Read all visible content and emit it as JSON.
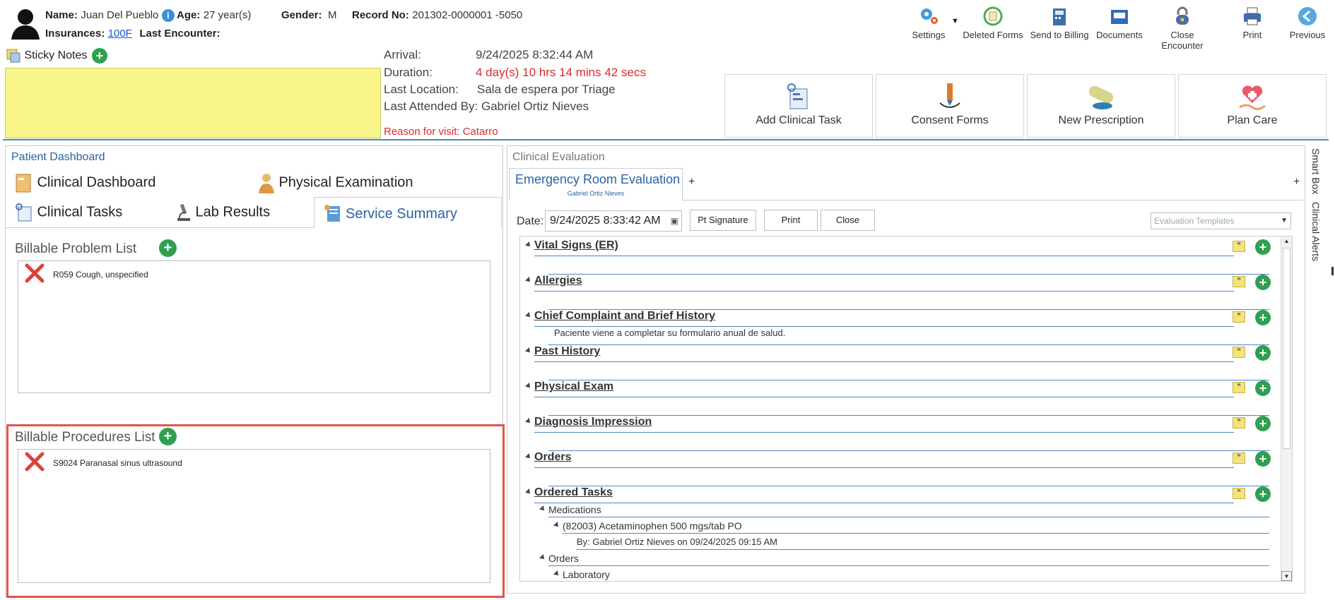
{
  "patient": {
    "name_label": "Name:",
    "name": "Juan Del Pueblo",
    "age_label": "Age:",
    "age": "27 year(s)",
    "gender_label": "Gender:",
    "gender": "M",
    "record_label": "Record No:",
    "record": "201302-0000001 -5050",
    "insurances_label": "Insurances:",
    "insurance": "100F",
    "last_encounter_label": "Last Encounter:"
  },
  "toolbar": {
    "settings": "Settings",
    "deleted_forms": "Deleted Forms",
    "send_to_billing": "Send to Billing",
    "documents": "Documents",
    "close_encounter": "Close Encounter",
    "print": "Print",
    "previous": "Previous"
  },
  "sticky": {
    "label": "Sticky Notes"
  },
  "encounter": {
    "arrival_label": "Arrival:",
    "arrival": "9/24/2025 8:32:44 AM",
    "duration_label": "Duration:",
    "duration": "4 day(s) 10 hrs 14 mins 42 secs",
    "last_location_label": "Last Location:",
    "last_location": "Sala de espera por Triage",
    "last_attended": "Last Attended By: Gabriel Ortiz Nieves",
    "reason": "Reason for visit: Catarro"
  },
  "actions": {
    "add_clinical_task": "Add Clinical Task",
    "consent_forms": "Consent Forms",
    "new_prescription": "New Prescription",
    "plan_care": "Plan Care"
  },
  "dashboard": {
    "title": "Patient Dashboard",
    "tabs": [
      "Clinical Dashboard",
      "Physical Examination",
      "Clinical Tasks",
      "Lab Results",
      "Service Summary"
    ],
    "problem_title": "Billable Problem List",
    "problem_item": "R059 Cough, unspecified",
    "procedures_title": "Billable Procedures List",
    "procedure_item": "S9024 Paranasal sinus ultrasound"
  },
  "evaluation": {
    "title": "Clinical Evaluation",
    "tab": "Emergency Room Evaluation",
    "tab_sub": "Gabriel Ortiz Nieves",
    "tab_add": "+",
    "right_add": "+",
    "date_label": "Date:",
    "date_value": "9/24/2025 8:33:42 AM",
    "pt_signature": "Pt Signature",
    "print": "Print",
    "close": "Close",
    "templates_placeholder": "Evaluation Templates",
    "sections": [
      "Vital Signs (ER)",
      "Allergies",
      "Chief Complaint and Brief History",
      "Past History",
      "Physical Exam",
      "Diagnosis Impression",
      "Orders",
      "Ordered Tasks"
    ],
    "chief_complaint_text": "Paciente viene a completar su formulario anual de salud.",
    "medications_label": "Medications",
    "medication_item": "(82003) Acetaminophen 500 mgs/tab PO",
    "medication_by": "By: Gabriel Ortiz Nieves on 09/24/2025 09:15 AM",
    "orders_label": "Orders",
    "laboratory_label": "Laboratory"
  },
  "side_tabs": {
    "smart_box": "Smart Box",
    "clinical_alerts": "Clinical Alerts"
  },
  "colors": {
    "accent_blue": "#2a62a8",
    "sticky_yellow": "#f8f688",
    "highlight_red": "#e0554d",
    "add_green": "#2fa04f",
    "duration_red": "#e02828"
  }
}
